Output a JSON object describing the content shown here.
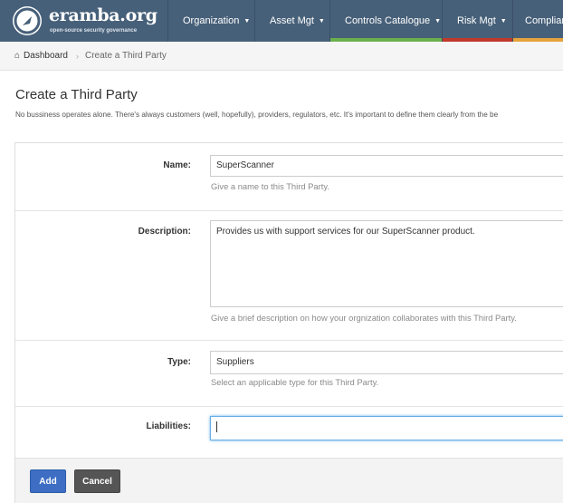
{
  "brand": {
    "name": "eramba.org",
    "tagline": "open-source security governance"
  },
  "nav": {
    "items": [
      {
        "label": "Organization",
        "accent": ""
      },
      {
        "label": "Asset Mgt",
        "accent": ""
      },
      {
        "label": "Controls Catalogue",
        "accent": "#6ab04c"
      },
      {
        "label": "Risk Mgt",
        "accent": "#c0392b"
      },
      {
        "label": "Complian",
        "accent": "#e6a23c"
      }
    ]
  },
  "breadcrumb": {
    "home": "Dashboard",
    "separator": "›",
    "current": "Create a Third Party"
  },
  "page": {
    "title": "Create a Third Party",
    "description": "No bussiness operates alone. There's always customers (well, hopefully), providers, regulators, etc. It's important to define them clearly from the be"
  },
  "form": {
    "name": {
      "label": "Name:",
      "value": "SuperScanner",
      "hint": "Give a name to this Third Party."
    },
    "description": {
      "label": "Description:",
      "value": "Provides us with support services for our SuperScanner product.",
      "hint": "Give a brief description on how your orgnization collaborates with this Third Party."
    },
    "type": {
      "label": "Type:",
      "value": "Suppliers",
      "hint": "Select an applicable type for this Third Party."
    },
    "liabilities": {
      "label": "Liabilities:",
      "value": ""
    }
  },
  "actions": {
    "add": "Add",
    "cancel": "Cancel"
  },
  "colors": {
    "navbar": "#476079",
    "add_button": "#3d6ec4",
    "cancel_button": "#555555"
  }
}
